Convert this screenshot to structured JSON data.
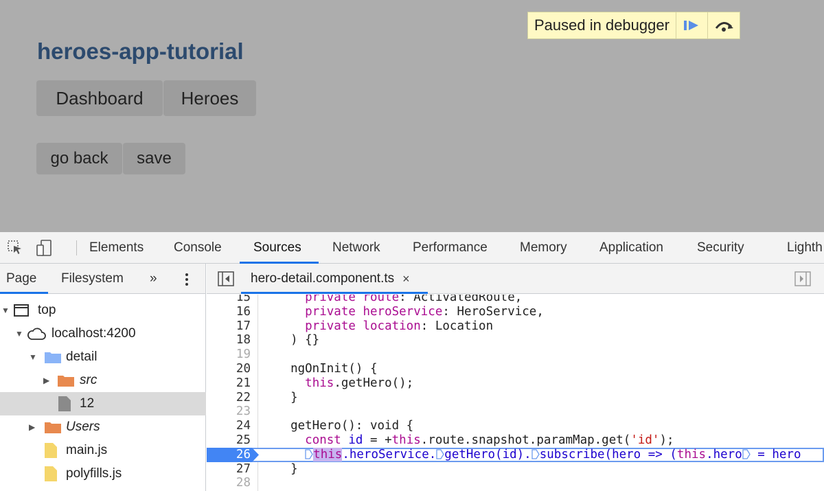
{
  "app": {
    "title": "heroes-app-tutorial",
    "nav": [
      "Dashboard",
      "Heroes"
    ],
    "buttons": [
      "go back",
      "save"
    ],
    "paused_text": "Paused in debugger",
    "paused_icons": [
      "resume-icon",
      "step-over-icon"
    ]
  },
  "devtools": {
    "tabs": [
      "Elements",
      "Console",
      "Sources",
      "Network",
      "Performance",
      "Memory",
      "Application",
      "Security",
      "Lighth"
    ],
    "active_tab": "Sources",
    "nav_tabs": [
      "Page",
      "Filesystem",
      "»"
    ],
    "tree": [
      {
        "label": "top"
      },
      {
        "label": "localhost:4200"
      },
      {
        "label": "detail"
      },
      {
        "label": "src"
      },
      {
        "label": "12"
      },
      {
        "label": "Users"
      },
      {
        "label": "main.js"
      },
      {
        "label": "polyfills.js"
      }
    ],
    "open_file": "hero-detail.component.ts",
    "close_glyph": "×",
    "code": [
      {
        "n": "15",
        "text": ""
      },
      {
        "n": "16",
        "text": ""
      },
      {
        "n": "17",
        "text": ""
      },
      {
        "n": "18",
        "text": ""
      },
      {
        "n": "19",
        "text": ""
      },
      {
        "n": "20",
        "text": ""
      },
      {
        "n": "21",
        "text": ""
      },
      {
        "n": "22",
        "text": ""
      },
      {
        "n": "23",
        "text": ""
      },
      {
        "n": "24",
        "text": ""
      },
      {
        "n": "25",
        "text": ""
      },
      {
        "n": "26",
        "text": ""
      },
      {
        "n": "27",
        "text": ""
      },
      {
        "n": "28",
        "text": ""
      }
    ],
    "current_line": "26",
    "colors": {
      "accent": "#1a73e8",
      "breakpoint": "#4285f4",
      "keyword": "#aa0d91",
      "string": "#c41a16"
    }
  }
}
